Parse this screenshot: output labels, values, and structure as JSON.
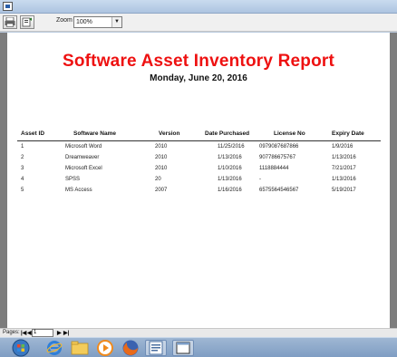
{
  "toolbar": {
    "zoom_label": "Zoom",
    "zoom_value": "100%",
    "icons": [
      "print-icon",
      "export-icon"
    ]
  },
  "report": {
    "title": "Software Asset Inventory Report",
    "date": "Monday, June 20, 2016",
    "title_color": "#ee1111",
    "columns": [
      "Asset ID",
      "Software Name",
      "Version",
      "Date Purchased",
      "License No",
      "Expiry Date"
    ],
    "rows": [
      [
        "1",
        "Microsoft Word",
        "2010",
        "11/25/2016",
        "0979087687866",
        "1/9/2016"
      ],
      [
        "2",
        "Dreamweaver",
        "2010",
        "1/13/2016",
        "907786675767",
        "1/13/2016"
      ],
      [
        "3",
        "Microsoft Excel",
        "2010",
        "1/10/2016",
        "1118884444",
        "7/21/2017"
      ],
      [
        "4",
        "SPSS",
        "20",
        "1/13/2016",
        "-",
        "1/13/2016"
      ],
      [
        "5",
        "MS Access",
        "2007",
        "1/16/2016",
        "6575564546567",
        "5/19/2017"
      ]
    ]
  },
  "statusbar": {
    "pages_label": "Pages:",
    "page_value": "1"
  },
  "taskbar": {
    "items": [
      "start-orb-icon",
      "ie-icon",
      "explorer-icon",
      "media-player-icon",
      "firefox-icon",
      "app-icon",
      "report-window-icon"
    ]
  }
}
